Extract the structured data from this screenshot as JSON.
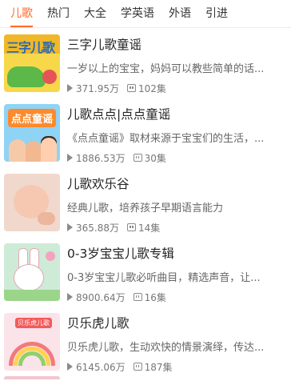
{
  "tabs": [
    {
      "label": "儿歌",
      "active": true
    },
    {
      "label": "热门",
      "active": false
    },
    {
      "label": "大全",
      "active": false
    },
    {
      "label": "学英语",
      "active": false
    },
    {
      "label": "外语",
      "active": false
    },
    {
      "label": "引进",
      "active": false
    }
  ],
  "colors": {
    "accent": "#ff6a2a"
  },
  "items": [
    {
      "title": "三字儿歌童谣",
      "desc": "一岁以上的宝宝，妈妈可以教些简单的话...",
      "plays": "371.95万",
      "episodes": "102集",
      "thumb_text": "三字儿歌"
    },
    {
      "title": "儿歌点点|点点童谣",
      "desc": "《点点童谣》取材来源于宝宝们的生活，...",
      "plays": "1886.53万",
      "episodes": "30集",
      "thumb_text": "点点童谣"
    },
    {
      "title": "儿歌欢乐谷",
      "desc": "经典儿歌，培养孩子早期语言能力",
      "plays": "365.88万",
      "episodes": "14集",
      "thumb_text": ""
    },
    {
      "title": "0-3岁宝宝儿歌专辑",
      "desc": "0-3岁宝宝儿歌必听曲目，精选声音，让...",
      "plays": "8900.64万",
      "episodes": "16集",
      "thumb_text": ""
    },
    {
      "title": "贝乐虎儿歌",
      "desc": "贝乐虎儿歌，生动欢快的情景演绎，传达...",
      "plays": "6145.06万",
      "episodes": "187集",
      "thumb_text": "贝乐虎儿歌"
    }
  ]
}
